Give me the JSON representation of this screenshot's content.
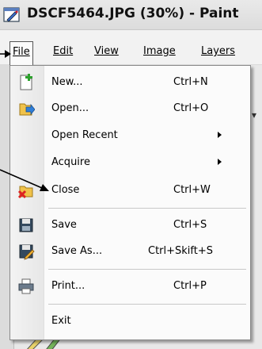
{
  "window": {
    "title": "DSCF5464.JPG (30%) - Paint"
  },
  "menubar": {
    "items": [
      {
        "label": "File",
        "active": true
      },
      {
        "label": "Edit"
      },
      {
        "label": "View"
      },
      {
        "label": "Image"
      },
      {
        "label": "Layers"
      }
    ]
  },
  "file_menu": {
    "items": [
      {
        "label": "New...",
        "shortcut": "Ctrl+N",
        "icon": "new-file-icon"
      },
      {
        "label": "Open...",
        "shortcut": "Ctrl+O",
        "icon": "open-file-icon"
      },
      {
        "label": "Open Recent",
        "has_submenu": true
      },
      {
        "label": "Acquire",
        "has_submenu": true
      },
      {
        "label": "Close",
        "shortcut": "Ctrl+W",
        "icon": "close-file-icon"
      },
      {
        "label": "Save",
        "shortcut": "Ctrl+S",
        "icon": "floppy-disk-icon"
      },
      {
        "label": "Save As...",
        "shortcut": "Ctrl+Skift+S",
        "icon": "save-as-icon"
      },
      {
        "label": "Print...",
        "shortcut": "Ctrl+P",
        "icon": "printer-icon"
      },
      {
        "label": "Exit"
      }
    ]
  },
  "colors": {
    "menu_bg": "#fbfbfb",
    "gutter": "#e7e7e7",
    "border": "#8a8a8a"
  }
}
